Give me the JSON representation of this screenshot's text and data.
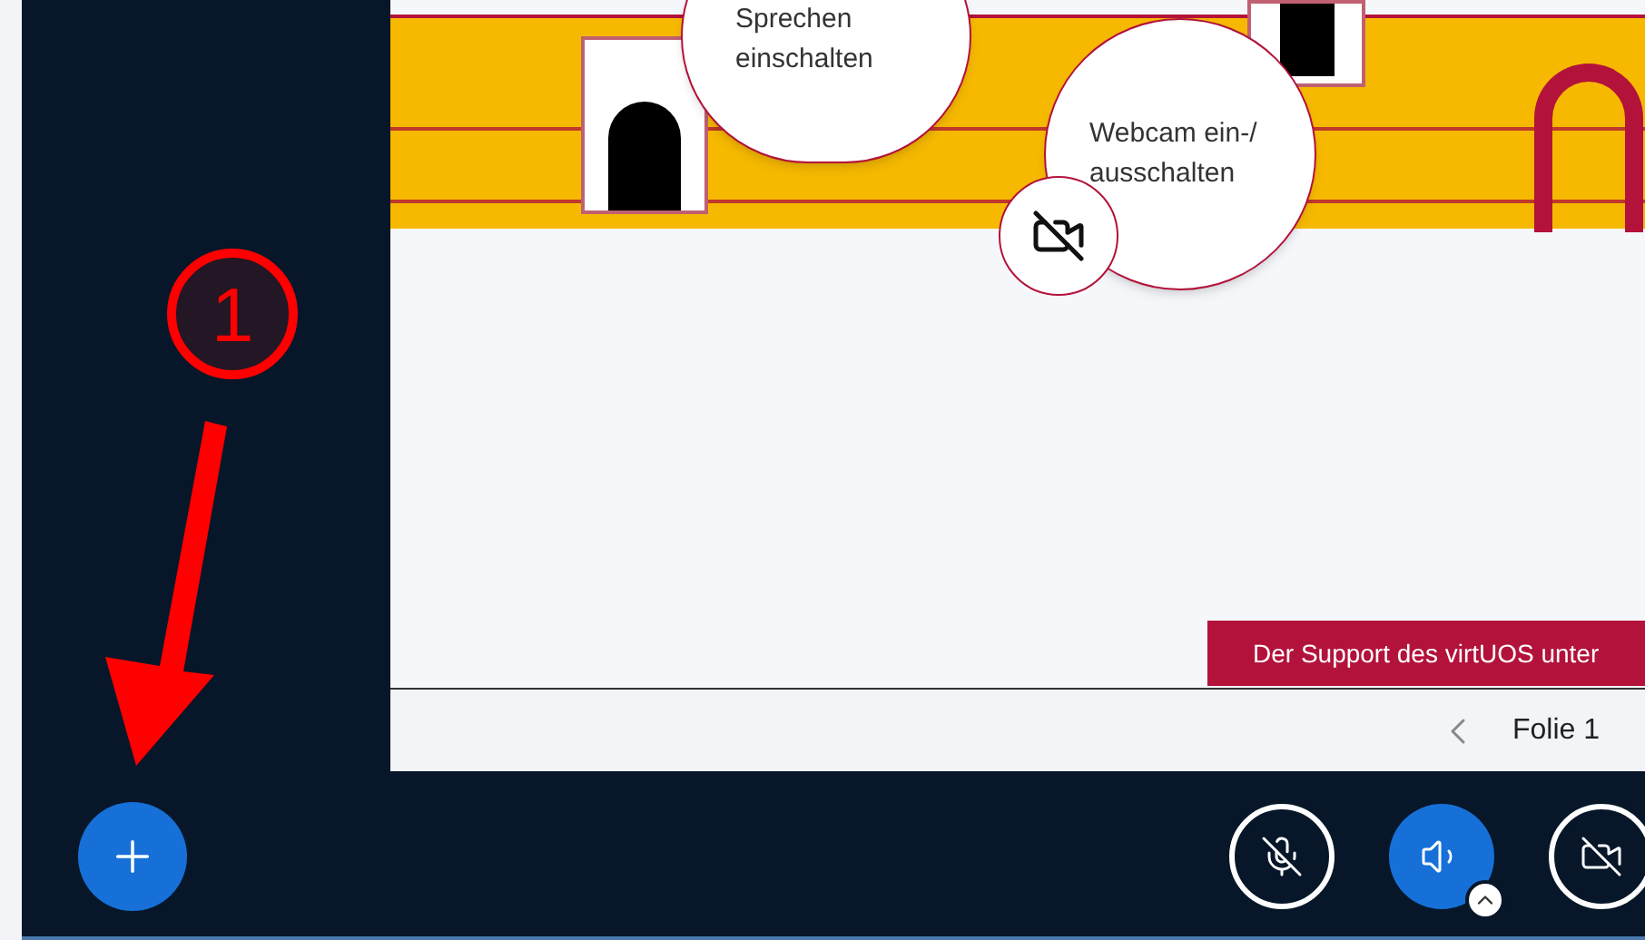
{
  "slide": {
    "bubbles": [
      {
        "kind": "speech",
        "text": "Sprechen einschalten"
      },
      {
        "kind": "webcam",
        "text": "Webcam ein-/ausschalten"
      }
    ],
    "banner": "Der Support des virtUOS unter"
  },
  "slide_nav": {
    "label": "Folie 1"
  },
  "annotation": {
    "label": "1"
  },
  "controls": [
    {
      "kind": "mic",
      "active": false
    },
    {
      "kind": "audio",
      "active": true
    },
    {
      "kind": "camera",
      "active": false
    }
  ]
}
